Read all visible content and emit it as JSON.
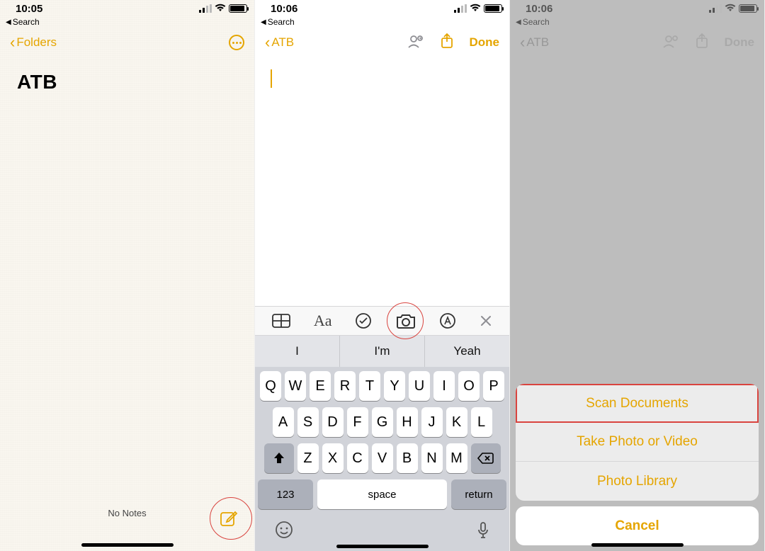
{
  "colors": {
    "accent": "#e5a500",
    "highlight": "#d9443f"
  },
  "phone1": {
    "time": "10:05",
    "breadcrumb": "Search",
    "back": "Folders",
    "title": "ATB",
    "no_notes": "No Notes"
  },
  "phone2": {
    "time": "10:06",
    "breadcrumb": "Search",
    "back": "ATB",
    "done": "Done",
    "toolbar_icons": [
      "table-icon",
      "text-format-icon",
      "checklist-icon",
      "camera-icon",
      "markup-icon",
      "close-icon"
    ],
    "suggestions": [
      "I",
      "I'm",
      "Yeah"
    ],
    "keys_row1": [
      "Q",
      "W",
      "E",
      "R",
      "T",
      "Y",
      "U",
      "I",
      "O",
      "P"
    ],
    "keys_row2": [
      "A",
      "S",
      "D",
      "F",
      "G",
      "H",
      "J",
      "K",
      "L"
    ],
    "keys_row3": [
      "Z",
      "X",
      "C",
      "V",
      "B",
      "N",
      "M"
    ],
    "key_123": "123",
    "key_space": "space",
    "key_return": "return"
  },
  "phone3": {
    "time": "10:06",
    "breadcrumb": "Search",
    "back": "ATB",
    "done": "Done",
    "sheet": {
      "scan": "Scan Documents",
      "photo": "Take Photo or Video",
      "library": "Photo Library",
      "cancel": "Cancel"
    }
  }
}
